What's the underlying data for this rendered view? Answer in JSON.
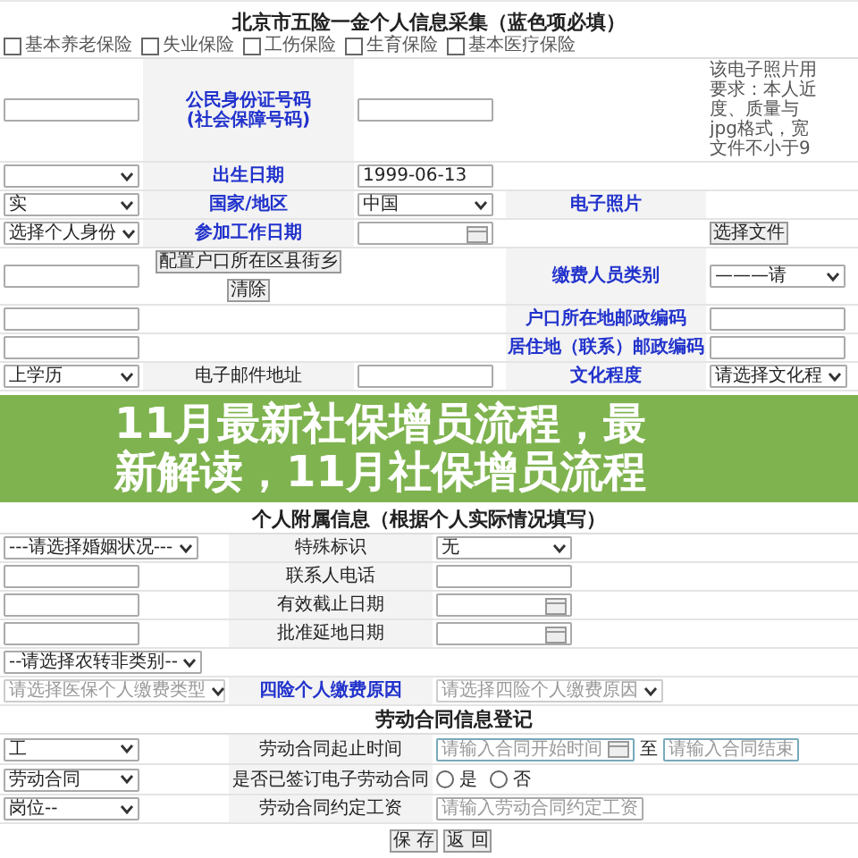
{
  "form_title": "北京市五险一金个人信息采集（蓝色项必填）",
  "insurance_options": [
    {
      "label": "基本养老保险",
      "checked": false
    },
    {
      "label": "失业保险",
      "checked": false
    },
    {
      "label": "工伤保险",
      "checked": false
    },
    {
      "label": "生育保险",
      "checked": false
    },
    {
      "label": "基本医疗保险",
      "checked": false
    }
  ],
  "main_rows": [
    {
      "cells": [
        {
          "kind": "input"
        },
        {
          "kind": "label",
          "text": "公民身份证号码\n(社会保障号码)",
          "required": true
        },
        {
          "kind": "input"
        },
        {
          "kind": "empty"
        },
        {
          "kind": "note",
          "lines": [
            "该电子照片用",
            "要求：本人近",
            "度、质量与",
            "jpg格式，宽",
            "文件不小于9"
          ]
        }
      ]
    },
    {
      "cells": [
        {
          "kind": "select"
        },
        {
          "kind": "label",
          "text": "出生日期",
          "required": true
        },
        {
          "kind": "input",
          "value": "1999-06-13"
        },
        {
          "kind": "empty"
        },
        {
          "kind": "empty"
        }
      ]
    },
    {
      "cells": [
        {
          "kind": "select",
          "value": "实"
        },
        {
          "kind": "label",
          "text": "国家/地区",
          "required": true
        },
        {
          "kind": "select",
          "value": "中国"
        },
        {
          "kind": "label",
          "text": "电子照片",
          "required": true
        },
        {
          "kind": "empty"
        }
      ]
    },
    {
      "cells": [
        {
          "kind": "select",
          "value": "选择个人身份"
        },
        {
          "kind": "label",
          "text": "参加工作日期",
          "required": true
        },
        {
          "kind": "date"
        },
        {
          "kind": "empty"
        },
        {
          "kind": "button",
          "text": "选择文件"
        }
      ]
    },
    {
      "cells": [
        {
          "kind": "input"
        },
        {
          "kind": "group",
          "items": [
            {
              "kind": "button",
              "text": "配置户口所在区县街乡"
            },
            {
              "kind": "button",
              "text": "清除"
            }
          ]
        },
        {
          "kind": "empty"
        },
        {
          "kind": "label",
          "text": "缴费人员类别",
          "required": true
        },
        {
          "kind": "select",
          "value": "———请"
        }
      ]
    },
    {
      "cells": [
        {
          "kind": "input"
        },
        {
          "kind": "empty"
        },
        {
          "kind": "empty"
        },
        {
          "kind": "label",
          "text": "户口所在地邮政编码",
          "required": true
        },
        {
          "kind": "input"
        }
      ]
    },
    {
      "cells": [
        {
          "kind": "input"
        },
        {
          "kind": "empty"
        },
        {
          "kind": "empty"
        },
        {
          "kind": "label",
          "text": "居住地（联系）邮政编码",
          "required": true
        },
        {
          "kind": "input"
        }
      ]
    },
    {
      "cells": [
        {
          "kind": "select",
          "value": "上学历"
        },
        {
          "kind": "label",
          "text": "电子邮件地址",
          "required": false
        },
        {
          "kind": "input"
        },
        {
          "kind": "label",
          "text": "文化程度",
          "required": true
        },
        {
          "kind": "select",
          "value": "请选择文化程"
        }
      ]
    }
  ],
  "banner": {
    "lines": [
      "11月最新社保增员流程，最",
      "新解读，11月社保增员流程"
    ]
  },
  "extra_title": "个人附属信息（根据个人实际情况填写）",
  "extra_rows": [
    {
      "cells": [
        {
          "kind": "select",
          "value": "---请选择婚姻状况---"
        },
        {
          "kind": "label",
          "text": "特殊标识",
          "required": false
        },
        {
          "kind": "select",
          "value": "无"
        }
      ]
    },
    {
      "cells": [
        {
          "kind": "input"
        },
        {
          "kind": "label",
          "text": "联系人电话",
          "required": false
        },
        {
          "kind": "input"
        }
      ]
    },
    {
      "cells": [
        {
          "kind": "input"
        },
        {
          "kind": "label",
          "text": "有效截止日期",
          "required": false
        },
        {
          "kind": "date"
        }
      ]
    },
    {
      "cells": [
        {
          "kind": "input"
        },
        {
          "kind": "label",
          "text": "批准延地日期",
          "required": false
        },
        {
          "kind": "date"
        }
      ]
    },
    {
      "cells": [
        {
          "kind": "select",
          "value": "--请选择农转非类别--"
        },
        {
          "kind": "empty"
        },
        {
          "kind": "empty"
        }
      ]
    },
    {
      "cells": [
        {
          "kind": "select",
          "placeholder": "请选择医保个人缴费类型",
          "disabled": true
        },
        {
          "kind": "label",
          "text": "四险个人缴费原因",
          "required": true
        },
        {
          "kind": "select",
          "placeholder": "请选择四险个人缴费原因",
          "disabled": true
        }
      ]
    }
  ],
  "contract_title": "劳动合同信息登记",
  "contract_rows": [
    {
      "cells": [
        {
          "kind": "select",
          "value": "工"
        },
        {
          "kind": "label",
          "text": "劳动合同起止时间",
          "required": false
        },
        {
          "kind": "range",
          "start": "请输入合同开始时间",
          "sep": "至",
          "end": "请输入合同结束"
        }
      ]
    },
    {
      "cells": [
        {
          "kind": "select",
          "value": "劳动合同"
        },
        {
          "kind": "label",
          "text": "是否已签订电子劳动合同",
          "required": false
        },
        {
          "kind": "radios",
          "options": [
            {
              "label": "是",
              "selected": false
            },
            {
              "label": "否",
              "selected": false
            }
          ]
        }
      ]
    },
    {
      "cells": [
        {
          "kind": "select",
          "value": "岗位--"
        },
        {
          "kind": "label",
          "text": "劳动合同约定工资",
          "required": false
        },
        {
          "kind": "input",
          "placeholder": "请输入劳动合同约定工资"
        }
      ]
    }
  ],
  "actions": [
    "保 存",
    "返 回"
  ]
}
